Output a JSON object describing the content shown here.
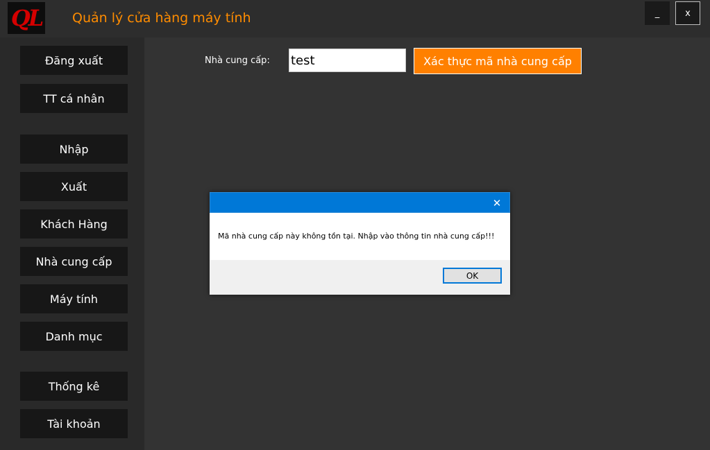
{
  "app": {
    "logo_text": "QL",
    "title": "Quản lý cửa hàng máy tính",
    "minimize_label": "_",
    "close_label": "x"
  },
  "sidebar": {
    "items": [
      {
        "label": "Đăng xuất"
      },
      {
        "label": "TT cá nhân"
      },
      {
        "label": "Nhập"
      },
      {
        "label": "Xuất"
      },
      {
        "label": "Khách Hàng"
      },
      {
        "label": "Nhà cung cấp"
      },
      {
        "label": "Máy tính"
      },
      {
        "label": "Danh mục"
      },
      {
        "label": "Thống kê"
      },
      {
        "label": "Tài khoản"
      }
    ]
  },
  "main": {
    "supplier_label": "Nhà cung cấp:",
    "supplier_value": "test",
    "verify_button": "Xác thực mã nhà cung cấp"
  },
  "dialog": {
    "close_glyph": "✕",
    "message": "Mã nhà cung cấp này không tồn tại. Nhập vào thông tin nhà cung cấp!!!",
    "ok_label": "OK"
  },
  "colors": {
    "accent": "#ff8000",
    "title": "#ff8c00",
    "dialog_titlebar": "#0078d7",
    "background": "#333333",
    "sidebar_button": "#171717"
  }
}
